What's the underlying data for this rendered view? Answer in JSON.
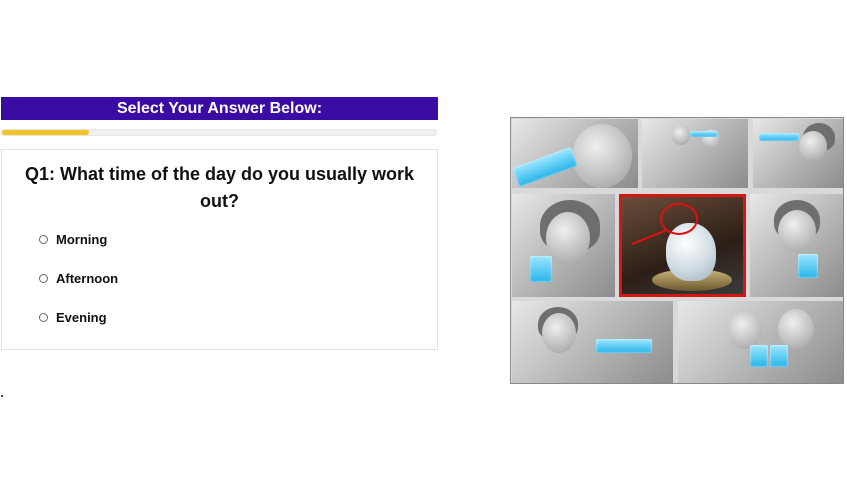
{
  "header": {
    "title": "Select Your Answer Below:"
  },
  "progress": {
    "fraction": 0.2
  },
  "question": {
    "text": "Q1: What time of the day do you usually work out?",
    "options": [
      "Morning",
      "Afternoon",
      "Evening"
    ]
  },
  "image": {
    "description_icon": "collage-image",
    "accent": "#d61515"
  },
  "colors": {
    "header_bg": "#3a0ca3",
    "progress_fill": "#f4c425",
    "glass": "#27b4ea"
  }
}
